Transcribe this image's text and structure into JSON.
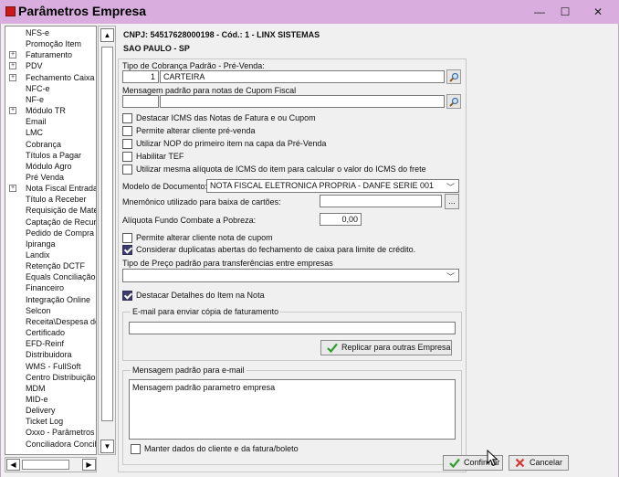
{
  "window": {
    "title": "Parâmetros Empresa",
    "minimize_glyph": "—",
    "maximize_glyph": "☐",
    "close_glyph": "✕"
  },
  "tree": {
    "items": [
      {
        "label": "NFS-e",
        "expandable": false
      },
      {
        "label": "Promoção Item",
        "expandable": false
      },
      {
        "label": "Faturamento",
        "expandable": true
      },
      {
        "label": "PDV",
        "expandable": true
      },
      {
        "label": "Fechamento Caixa",
        "expandable": true
      },
      {
        "label": "NFC-e",
        "expandable": false
      },
      {
        "label": "NF-e",
        "expandable": false
      },
      {
        "label": "Módulo TR",
        "expandable": true
      },
      {
        "label": "Email",
        "expandable": false
      },
      {
        "label": "LMC",
        "expandable": false
      },
      {
        "label": "Cobrança",
        "expandable": false
      },
      {
        "label": "Títulos a Pagar",
        "expandable": false
      },
      {
        "label": "Módulo Agro",
        "expandable": false
      },
      {
        "label": "Pré Venda",
        "expandable": false
      },
      {
        "label": "Nota Fiscal Entrada",
        "expandable": true
      },
      {
        "label": "Título a Receber",
        "expandable": false
      },
      {
        "label": "Requisição de Materia",
        "expandable": false
      },
      {
        "label": "Captação de Recurso",
        "expandable": false
      },
      {
        "label": "Pedido de Compra",
        "expandable": false
      },
      {
        "label": "Ipiranga",
        "expandable": false
      },
      {
        "label": "Landix",
        "expandable": false
      },
      {
        "label": "Retenção DCTF",
        "expandable": false
      },
      {
        "label": "Equals Conciliação",
        "expandable": false
      },
      {
        "label": "Financeiro",
        "expandable": false
      },
      {
        "label": "Integração Online",
        "expandable": false
      },
      {
        "label": "Selcon",
        "expandable": false
      },
      {
        "label": "Receita\\Despesa de T",
        "expandable": false
      },
      {
        "label": "Certificado",
        "expandable": false
      },
      {
        "label": "EFD-Reinf",
        "expandable": false
      },
      {
        "label": "Distribuidora",
        "expandable": false
      },
      {
        "label": "WMS - FullSoft",
        "expandable": false
      },
      {
        "label": "Centro Distribuição",
        "expandable": false
      },
      {
        "label": "MDM",
        "expandable": false
      },
      {
        "label": "MID-e",
        "expandable": false
      },
      {
        "label": "Delivery",
        "expandable": false
      },
      {
        "label": "Ticket Log",
        "expandable": false
      },
      {
        "label": "Oxxo - Parâmetros",
        "expandable": false
      },
      {
        "label": "Conciliadora Conciliac",
        "expandable": false
      }
    ],
    "expander_glyph": "+",
    "scroll_up_glyph": "▲",
    "scroll_down_glyph": "▼",
    "scroll_left_glyph": "◀",
    "scroll_right_glyph": "▶"
  },
  "header": {
    "line1": "CNPJ: 54517628000198 - Cód.: 1 - LINX SISTEMAS",
    "line2": "SAO PAULO - SP"
  },
  "form": {
    "cobranca_label": "Tipo de Cobrança Padrão - Pré-Venda:",
    "cobranca_code": "1",
    "cobranca_name": "CARTEIRA",
    "cupom_label": "Mensagem padrão para notas de Cupom Fiscal",
    "cupom_code": "",
    "cupom_name": "",
    "checkboxes_top": [
      {
        "label": "Destacar ICMS das Notas de Fatura e ou Cupom",
        "checked": false
      },
      {
        "label": "Permite alterar cliente pré-venda",
        "checked": false
      },
      {
        "label": "Utilizar NOP do primeiro item na capa da Pré-Venda",
        "checked": false
      },
      {
        "label": "Habilitar TEF",
        "checked": false
      },
      {
        "label": "Utilizar mesma alíquota de ICMS do item para calcular o valor do ICMS do frete",
        "checked": false
      }
    ],
    "modelo_label": "Modelo de Documento:",
    "modelo_value": "NOTA FISCAL ELETRONICA PROPRIA - DANFE SERIE 001",
    "mnemonico_label": "Mnemônico utilizado para baixa de cartões:",
    "mnemonico_value": "",
    "ellipsis_label": "...",
    "aliquota_label": "Alíquota Fundo Combate a Pobreza:",
    "aliquota_value": "0,00",
    "checkboxes_mid": [
      {
        "label": "Permite alterar cliente nota de cupom",
        "checked": false
      },
      {
        "label": "Considerar duplicatas abertas do fechamento de caixa para limite de crédito.",
        "checked": true
      }
    ],
    "preco_label": "Tipo de Preço padrão para transferências entre empresas",
    "preco_value": "",
    "destacar_itens_label": "Destacar Detalhes do Item na Nota",
    "destacar_itens_checked": true,
    "email_group_title": "E-mail para enviar cópia de faturamento",
    "email_value": "",
    "replicar_label": "Replicar para outras Empresa",
    "msg_email_group_title": "Mensagem padrão para e-mail",
    "msg_email_value": "Mensagem padrão parametro empresa",
    "manter_label": "Manter dados do cliente e da fatura/boleto",
    "manter_checked": false,
    "caret_glyph": "﹀"
  },
  "footer": {
    "confirm_label": "Confirmar",
    "cancel_label": "Cancelar"
  },
  "colors": {
    "titlebar": "#d9aedf",
    "check_fill": "#3b3b6e",
    "confirm_icon": "#2e9e2e",
    "cancel_icon": "#d23a3a"
  }
}
